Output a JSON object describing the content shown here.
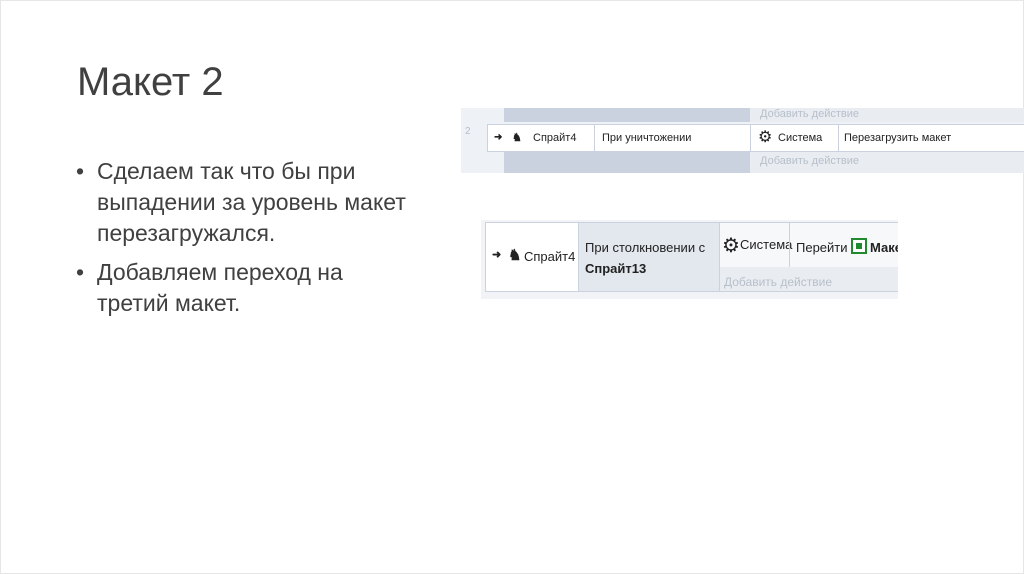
{
  "slide": {
    "title": "Макет 2",
    "bullets": [
      "Сделаем так что бы при выпадении за уровень макет перезагружался.",
      "Добавляем переход на третий макет."
    ],
    "bullet_symbol": "•"
  },
  "screenshot1": {
    "add_action_top": "Добавить действие",
    "row_number": "2",
    "arrow_glyph": "➜",
    "object_name": "Спрайт4",
    "condition": "При уничтожении",
    "system_label": "Система",
    "action": "Перезагрузить макет",
    "add_action_bottom": "Добавить действие"
  },
  "screenshot2": {
    "arrow_glyph": "➜",
    "object_name": "Спрайт4",
    "condition_line1": "При столкновении с",
    "condition_line2": "Спрайт13",
    "system_label": "Система",
    "action_prefix": "Перейти к",
    "action_target": "Макет",
    "add_action": "Добавить действие"
  },
  "colors": {
    "text": "#404040",
    "system_gear": "#2f6eb0",
    "event_arrow": "#2e9e3b",
    "layout_green": "#1f8a2e"
  }
}
